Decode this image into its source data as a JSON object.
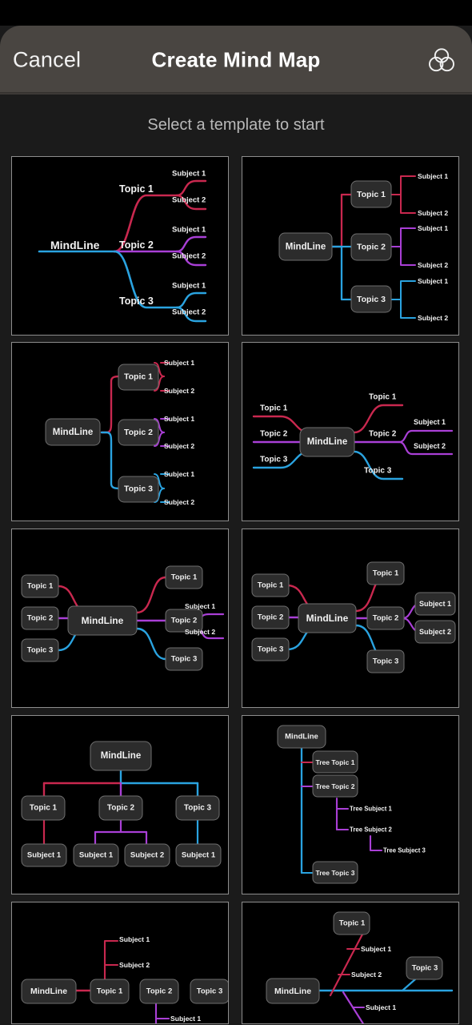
{
  "window": {
    "background_color": "#1b1b1b",
    "canvas_color": "#000000"
  },
  "navbar": {
    "cancel_label": "Cancel",
    "title": "Create Mind Map",
    "action_icon": "three-overlapping-circles-icon",
    "background_color": "#494541"
  },
  "subtitle": "Select a template to start",
  "palette": {
    "crimson": "#c9284f",
    "purple": "#a93fd6",
    "blue": "#2aa3e0",
    "node_fill": "#2c2c2c",
    "node_stroke": "#6e6e6e",
    "text": "#f0f0f0",
    "card_border": "#8d8d8d"
  },
  "labels": {
    "root": "MindLine",
    "topic1": "Topic 1",
    "topic2": "Topic 2",
    "topic3": "Topic 3",
    "subject1": "Subject 1",
    "subject2": "Subject 2",
    "tree_topic1": "Tree Topic 1",
    "tree_topic2": "Tree Topic 2",
    "tree_topic3": "Tree Topic 3",
    "tree_subject1": "Tree Subject 1",
    "tree_subject2": "Tree Subject 2",
    "tree_subject3": "Tree Subject 3"
  },
  "templates": [
    {
      "id": "template-1",
      "name": "right-logic-lines-no-boxes",
      "row": 1,
      "col": 1,
      "nodes": [
        "MindLine",
        "Topic 1",
        "Topic 2",
        "Topic 3",
        "Subject 1",
        "Subject 2",
        "Subject 1",
        "Subject 2",
        "Subject 1",
        "Subject 2"
      ]
    },
    {
      "id": "template-2",
      "name": "right-orthogonal-boxed",
      "row": 1,
      "col": 2,
      "nodes": [
        "MindLine",
        "Topic 1",
        "Topic 2",
        "Topic 3",
        "Subject 1",
        "Subject 2",
        "Subject 1",
        "Subject 2",
        "Subject 1",
        "Subject 2"
      ]
    },
    {
      "id": "template-3",
      "name": "right-bracket-boxed",
      "row": 2,
      "col": 1,
      "nodes": [
        "MindLine",
        "Topic 1",
        "Topic 2",
        "Topic 3",
        "Subject 1",
        "Subject 2",
        "Subject 1",
        "Subject 2",
        "Subject 1",
        "Subject 2"
      ]
    },
    {
      "id": "template-4",
      "name": "two-sided-curved-no-boxes",
      "row": 2,
      "col": 2,
      "nodes": [
        "MindLine",
        "Topic 1",
        "Topic 2",
        "Topic 3",
        "Topic 1",
        "Topic 2",
        "Topic 3",
        "Subject 1",
        "Subject 2"
      ]
    },
    {
      "id": "template-5",
      "name": "two-sided-curved-boxed-left",
      "row": 3,
      "col": 1,
      "nodes": [
        "MindLine",
        "Topic 1",
        "Topic 2",
        "Topic 3",
        "Topic 1",
        "Topic 2",
        "Topic 3",
        "Subject 1",
        "Subject 2"
      ]
    },
    {
      "id": "template-6",
      "name": "two-sided-curved-all-boxed",
      "row": 3,
      "col": 2,
      "nodes": [
        "MindLine",
        "Topic 1",
        "Topic 2",
        "Topic 3",
        "Topic 1",
        "Topic 2",
        "Topic 3",
        "Subject 1",
        "Subject 2"
      ]
    },
    {
      "id": "template-7",
      "name": "org-chart-top-down",
      "row": 4,
      "col": 1,
      "nodes": [
        "MindLine",
        "Topic 1",
        "Topic 2",
        "Topic 3",
        "Subject 1",
        "Subject 1",
        "Subject 2",
        "Subject 1"
      ]
    },
    {
      "id": "template-8",
      "name": "tree-indented",
      "row": 4,
      "col": 2,
      "nodes": [
        "MindLine",
        "Tree Topic 1",
        "Tree Topic 2",
        "Tree Topic 3",
        "Tree Subject 1",
        "Tree Subject 2",
        "Tree Subject 3"
      ]
    },
    {
      "id": "template-9",
      "name": "timeline-horizontal",
      "row": 5,
      "col": 1,
      "nodes": [
        "MindLine",
        "Topic 1",
        "Topic 2",
        "Topic 3",
        "Subject 1",
        "Subject 2",
        "Subject 1"
      ]
    },
    {
      "id": "template-10",
      "name": "fishbone",
      "row": 5,
      "col": 2,
      "nodes": [
        "MindLine",
        "Topic 1",
        "Topic 3",
        "Subject 1",
        "Subject 2",
        "Subject 1"
      ]
    }
  ]
}
